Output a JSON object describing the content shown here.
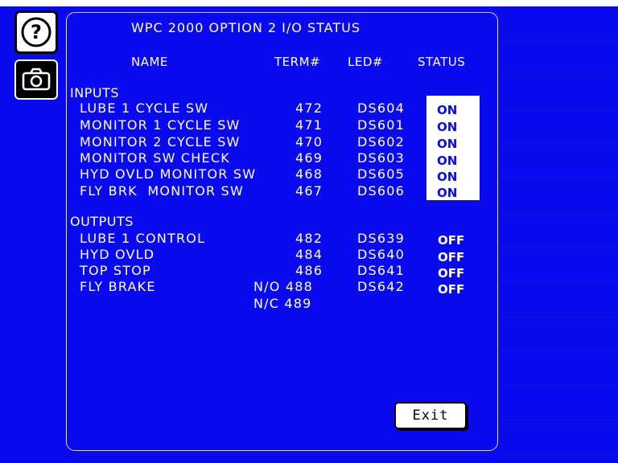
{
  "title": "WPC 2000 OPTION 2 I/O STATUS",
  "headers": {
    "name": "NAME",
    "term": "TERM#",
    "led": "LED#",
    "status": "STATUS"
  },
  "inputs_label": "INPUTS",
  "inputs": [
    {
      "name": "LUBE 1 CYCLE SW",
      "term": "472",
      "led": "DS604",
      "status": "ON"
    },
    {
      "name": "MONITOR 1 CYCLE SW",
      "term": "471",
      "led": "DS601",
      "status": "ON"
    },
    {
      "name": "MONITOR 2 CYCLE SW",
      "term": "470",
      "led": "DS602",
      "status": "ON"
    },
    {
      "name": "MONITOR SW CHECK",
      "term": "469",
      "led": "DS603",
      "status": "ON"
    },
    {
      "name": "HYD OVLD MONITOR SW",
      "term": "468",
      "led": "DS605",
      "status": "ON"
    },
    {
      "name": "FLY BRK  MONITOR SW",
      "term": "467",
      "led": "DS606",
      "status": "ON"
    }
  ],
  "outputs_label": "OUTPUTS",
  "outputs": [
    {
      "name": "LUBE 1 CONTROL",
      "term": "482",
      "led": "DS639",
      "status": "OFF"
    },
    {
      "name": "HYD OVLD",
      "term": "484",
      "led": "DS640",
      "status": "OFF"
    },
    {
      "name": "TOP STOP",
      "term": "486",
      "led": "DS641",
      "status": "OFF"
    },
    {
      "name": "FLY BRAKE",
      "term": "N/O 488",
      "led": "DS642",
      "status": "OFF"
    }
  ],
  "extra_term": "N/C 489",
  "exit_label": "Exit",
  "colors": {
    "background": "#0a0af0",
    "text": "#ffffff",
    "on_box": "#ffffff"
  },
  "icons": {
    "help": "help-icon",
    "camera": "camera-icon"
  }
}
